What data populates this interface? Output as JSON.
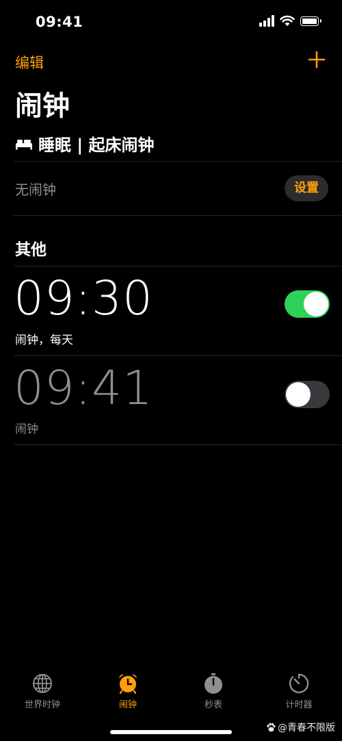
{
  "status_bar": {
    "time": "09:41"
  },
  "nav": {
    "edit_label": "编辑"
  },
  "page_title": "闹钟",
  "sleep": {
    "header": "睡眠 | 起床闹钟",
    "no_alarm": "无闹钟",
    "setup_label": "设置"
  },
  "others": {
    "title": "其他"
  },
  "alarms": [
    {
      "time": "09:30",
      "label": "闹钟，每天",
      "enabled": true
    },
    {
      "time": "09:41",
      "label": "闹钟",
      "enabled": false
    }
  ],
  "tabs": [
    {
      "label": "世界时钟",
      "icon": "globe-icon",
      "active": false
    },
    {
      "label": "闹钟",
      "icon": "alarm-clock-icon",
      "active": true
    },
    {
      "label": "秒表",
      "icon": "stopwatch-icon",
      "active": false
    },
    {
      "label": "计时器",
      "icon": "timer-icon",
      "active": false
    }
  ],
  "watermark": "@青春不限版",
  "colors": {
    "accent": "#ff9f0a",
    "toggle_on": "#30d158",
    "toggle_off": "#39393d",
    "background": "#000000"
  }
}
